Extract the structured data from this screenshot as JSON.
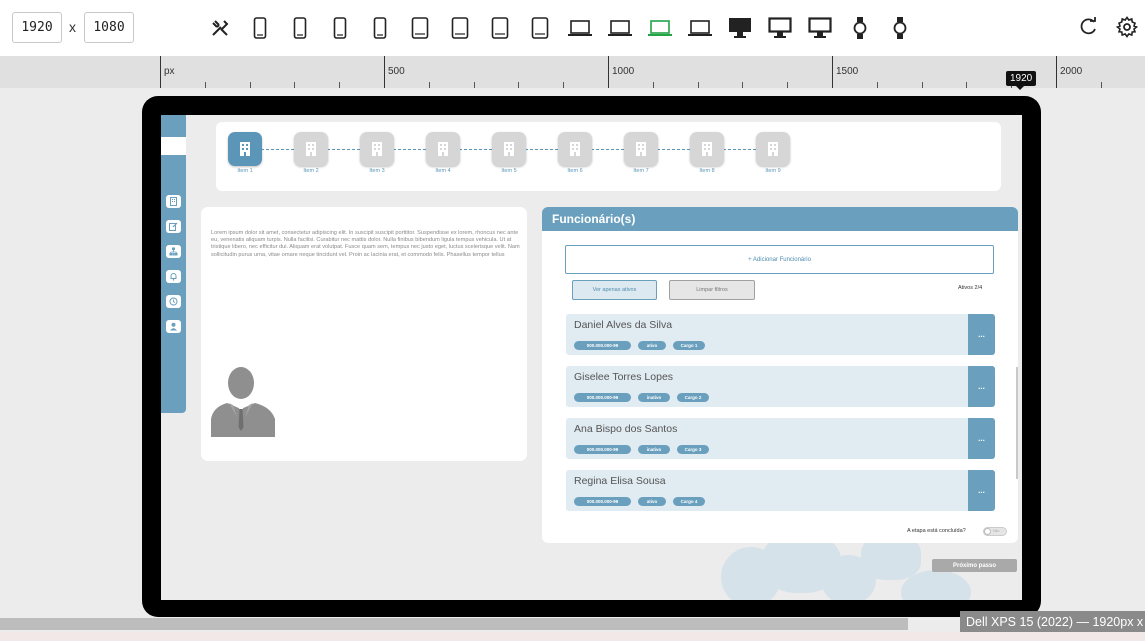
{
  "toolbar": {
    "width_value": "1920",
    "height_value": "1080",
    "separator": "x",
    "devices": [
      "tools",
      "phone",
      "phone",
      "phone",
      "phone",
      "tablet",
      "tablet",
      "tablet",
      "tablet",
      "laptop",
      "laptop",
      "laptop",
      "laptop",
      "desktop",
      "desktop",
      "desktop",
      "watch",
      "watch"
    ],
    "active_device_index": 11,
    "accent_color": "#22a447"
  },
  "ruler": {
    "unit": "px",
    "labels": [
      "500",
      "1000",
      "1500",
      "2000"
    ],
    "current_width": "1920"
  },
  "stepper": {
    "items": [
      "Item 1",
      "Item 2",
      "Item 3",
      "Item 4",
      "Item 5",
      "Item 6",
      "Item 7",
      "Item 8",
      "Item 9"
    ],
    "active_index": 0
  },
  "sidebar": {
    "icons": [
      "building-icon",
      "edit-icon",
      "org-chart-icon",
      "bell-icon",
      "history-icon",
      "user-icon"
    ]
  },
  "description": {
    "text": "Lorem ipsum dolor sit amet, consectetur adipiscing elit. In suscipit suscipit porttitor. Suspendisse ex lorem, rhoncus nec ante eu, venenatis aliquam turpis. Nulla facilisi. Curabitur nec mattis dolor. Nulla finibus bibendum ligula tempus vehicula. Ut at tristique libero, nec efficitur dui. Aliquam erat volutpat. Fusce quam sem, tempus nec justo eget, luctus scelerisque velit. Nam sollicitudin purus urna, vitae ornare neque tincidunt vel. Proin ac lacinia erat, et commodo felis. Phasellus tempor tellus"
  },
  "employees_panel": {
    "title": "Funcionário(s)",
    "add_label": "+ Adicionar Funcionário",
    "filter_active_label": "Ver apenas ativos",
    "filter_clear_label": "Limpar filtros",
    "active_count": "Ativos 2/4",
    "menu_label": "...",
    "employees": [
      {
        "name": "Daniel Alves da Silva",
        "cpf": "000.000.000-99",
        "status": "ativo",
        "role": "Cargo 1"
      },
      {
        "name": "Giselee Torres Lopes",
        "cpf": "000.000.000-99",
        "status": "inativo",
        "role": "Cargo 2"
      },
      {
        "name": "Ana Bispo dos Santos",
        "cpf": "000.000.000-99",
        "status": "inativo",
        "role": "Cargo 3"
      },
      {
        "name": "Regina Elisa Sousa",
        "cpf": "000.000.000-99",
        "status": "ativo",
        "role": "Cargo 4"
      }
    ],
    "step_done_label": "A etapa está concluída?",
    "toggle_label": "Não",
    "primary_color": "#6aa0be"
  },
  "footer": {
    "next_label": "Próximo passo",
    "device_name": "Dell XPS 15 (2022) — 1920px x"
  }
}
